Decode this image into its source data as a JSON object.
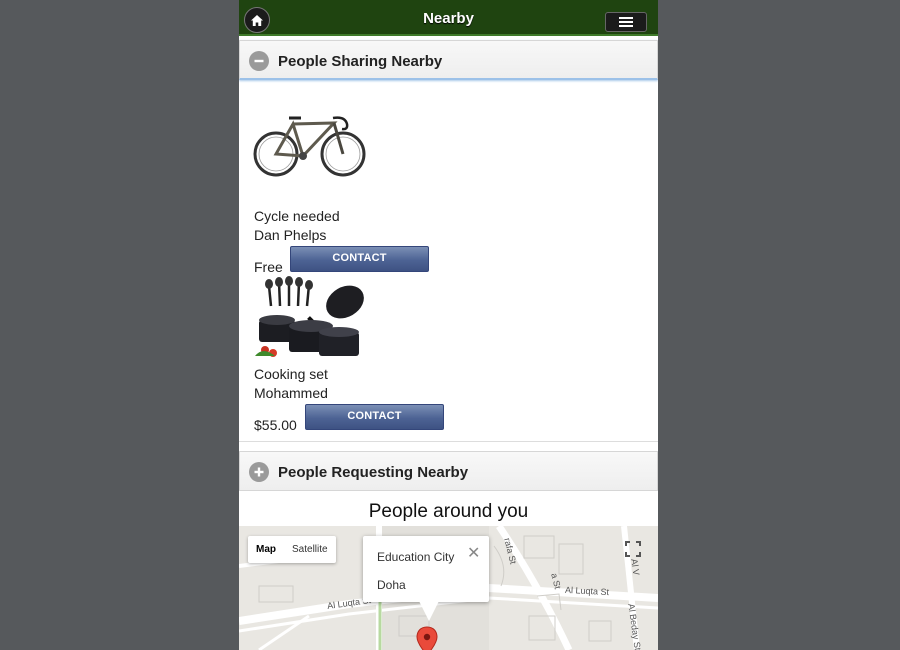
{
  "header": {
    "title": "Nearby",
    "home_icon": "home-icon",
    "menu_icon": "menu-icon",
    "bar_color": "#1f4410"
  },
  "sharing": {
    "title": "People Sharing Nearby",
    "collapse_icon": "minus-icon",
    "items": [
      {
        "title": "Cycle needed",
        "name": "Dan Phelps",
        "price": "Free",
        "button": "CONTACT",
        "image": "bicycle"
      },
      {
        "title": "Cooking set",
        "name": "Mohammed",
        "price": "$55.00",
        "button": "CONTACT",
        "image": "cookware set"
      }
    ]
  },
  "requesting": {
    "title": "People Requesting Nearby",
    "expand_icon": "plus-icon"
  },
  "map_section": {
    "title": "People around you",
    "map_button": "Map",
    "satellite_button": "Satellite",
    "info_window": {
      "place": "Education City",
      "city": "Doha",
      "close": "✕"
    },
    "streets": [
      "Al Luqta St",
      "Al Luqta St",
      "Al Beday St",
      "Al V",
      "rafa St",
      "a St"
    ]
  }
}
